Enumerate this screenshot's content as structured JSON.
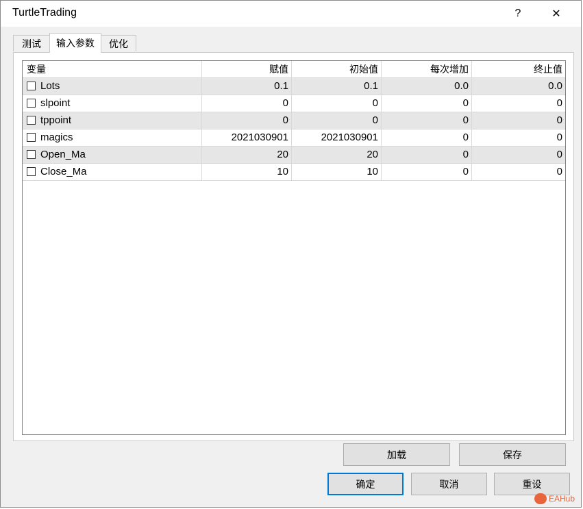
{
  "window": {
    "title": "TurtleTrading",
    "help_glyph": "?",
    "close_glyph": "✕"
  },
  "tabs": [
    {
      "label": "测试",
      "active": false
    },
    {
      "label": "输入参数",
      "active": true
    },
    {
      "label": "优化",
      "active": false
    }
  ],
  "table": {
    "headers": [
      "变量",
      "赋值",
      "初始值",
      "每次增加",
      "终止值"
    ],
    "rows": [
      {
        "name": "Lots",
        "value": "0.1",
        "start": "0.1",
        "step": "0.0",
        "stop": "0.0"
      },
      {
        "name": "slpoint",
        "value": "0",
        "start": "0",
        "step": "0",
        "stop": "0"
      },
      {
        "name": "tppoint",
        "value": "0",
        "start": "0",
        "step": "0",
        "stop": "0"
      },
      {
        "name": "magics",
        "value": "2021030901",
        "start": "2021030901",
        "step": "0",
        "stop": "0"
      },
      {
        "name": "Open_Ma",
        "value": "20",
        "start": "20",
        "step": "0",
        "stop": "0"
      },
      {
        "name": "Close_Ma",
        "value": "10",
        "start": "10",
        "step": "0",
        "stop": "0"
      }
    ]
  },
  "buttons": {
    "load": "加载",
    "save": "保存",
    "ok": "确定",
    "cancel": "取消",
    "reset": "重设"
  },
  "watermark": "EAHub",
  "colors": {
    "accent": "#0078d7",
    "shaded_row": "#e6e6e6",
    "dialog_bg": "#f0f0f0"
  }
}
